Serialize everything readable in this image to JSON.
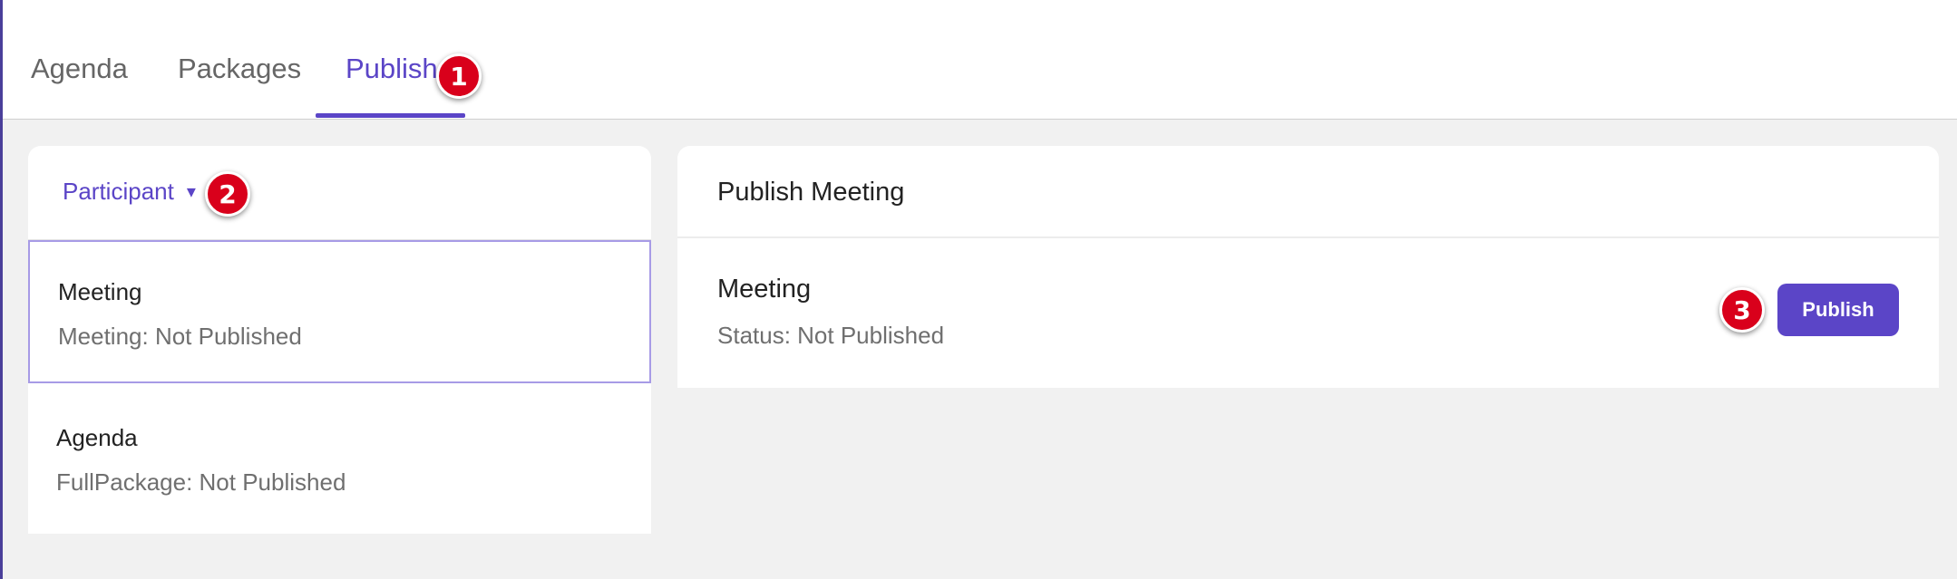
{
  "tabs": [
    {
      "label": "Agenda",
      "active": false
    },
    {
      "label": "Packages",
      "active": false
    },
    {
      "label": "Publish",
      "active": true
    }
  ],
  "markers": [
    "1",
    "2",
    "3"
  ],
  "left_panel": {
    "role_select": {
      "value": "Participant",
      "icon": "chevron-down-icon"
    },
    "items": [
      {
        "title": "Meeting",
        "status": "Meeting: Not Published",
        "selected": true
      },
      {
        "title": "Agenda",
        "status": "FullPackage: Not Published",
        "selected": false
      }
    ]
  },
  "right_panel": {
    "heading": "Publish Meeting",
    "item_title": "Meeting",
    "item_status": "Status: Not Published",
    "publish_label": "Publish"
  },
  "colors": {
    "accent": "#5b45c7",
    "marker": "#d9001b",
    "background": "#f1f1f1"
  }
}
